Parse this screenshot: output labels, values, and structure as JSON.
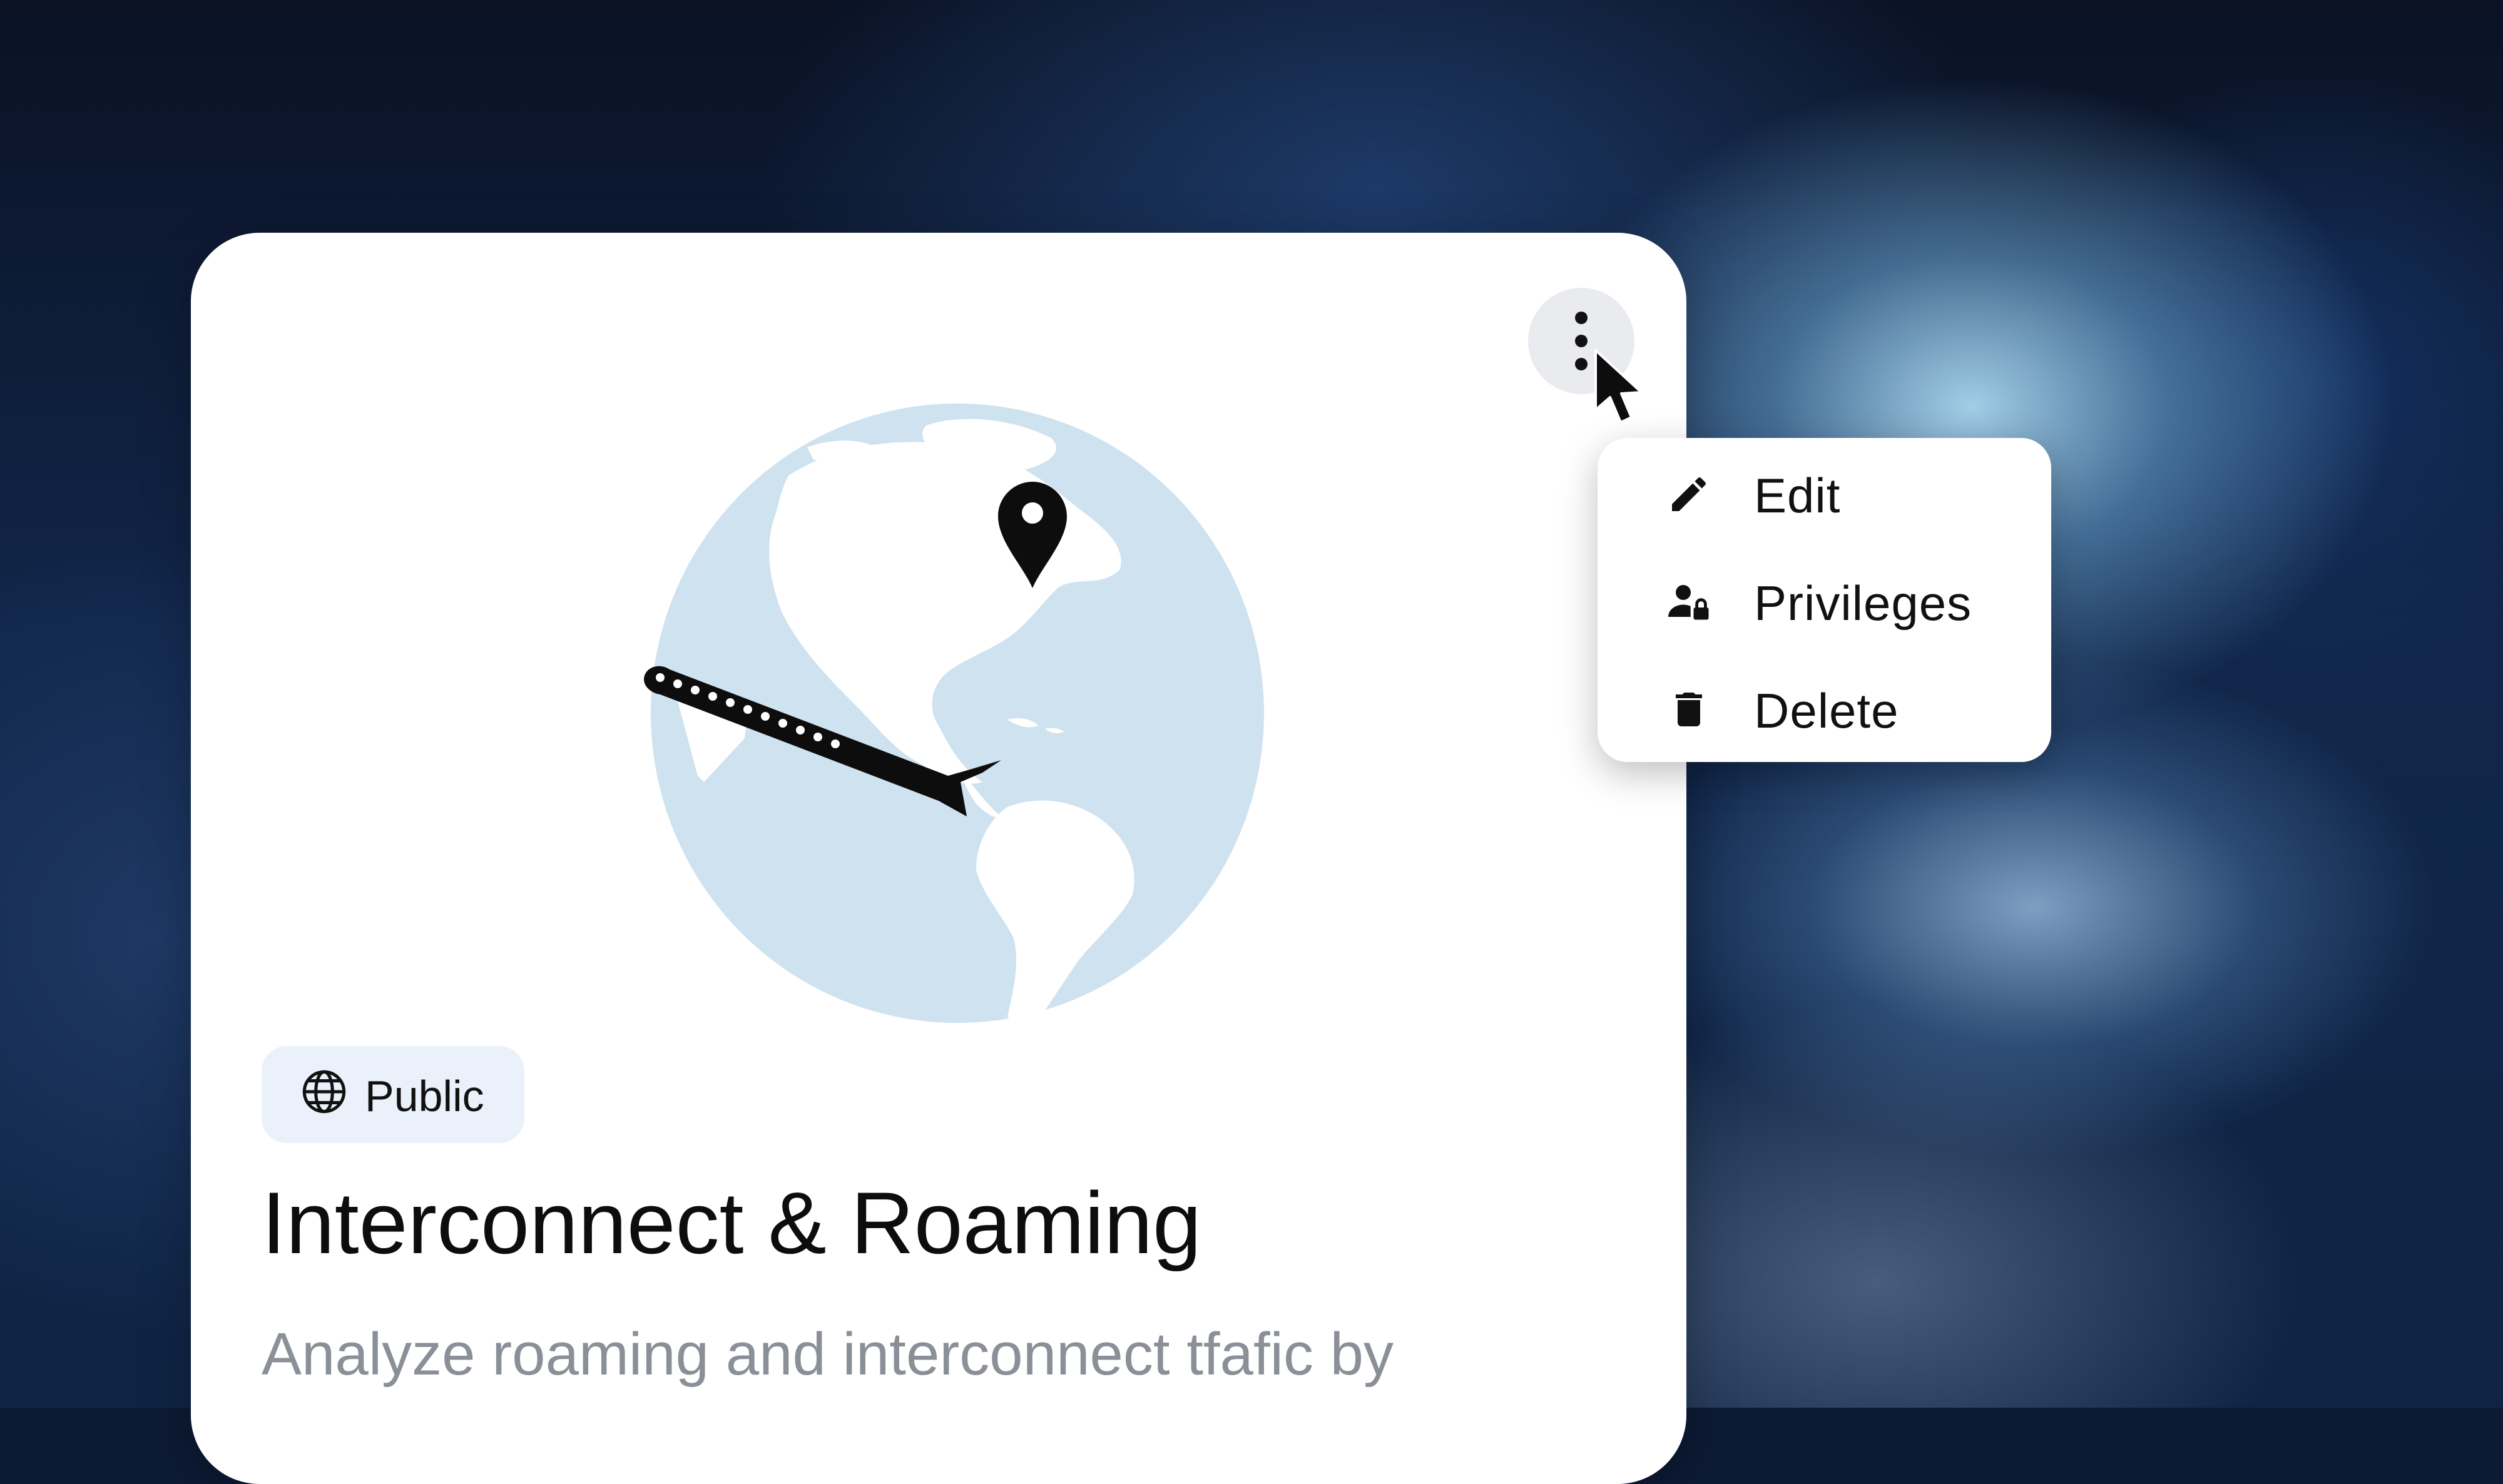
{
  "card": {
    "badge_label": "Public",
    "title": "Interconnect & Roaming",
    "description": "Analyze roaming and interconnect tfafic by"
  },
  "menu": {
    "items": [
      {
        "label": "Edit",
        "icon": "pencil-icon"
      },
      {
        "label": "Privileges",
        "icon": "user-lock-icon"
      },
      {
        "label": "Delete",
        "icon": "trash-icon"
      }
    ]
  },
  "icons": {
    "more": "vertical-ellipsis-icon",
    "badge": "globe-icon",
    "cursor": "mouse-pointer",
    "illustration": "globe-airplane-illustration"
  },
  "colors": {
    "globe_ocean": "#cfe2ef",
    "badge_bg": "#eaf1fb",
    "kebab_bg": "#e9ebef",
    "description_text": "#8a8f98"
  }
}
